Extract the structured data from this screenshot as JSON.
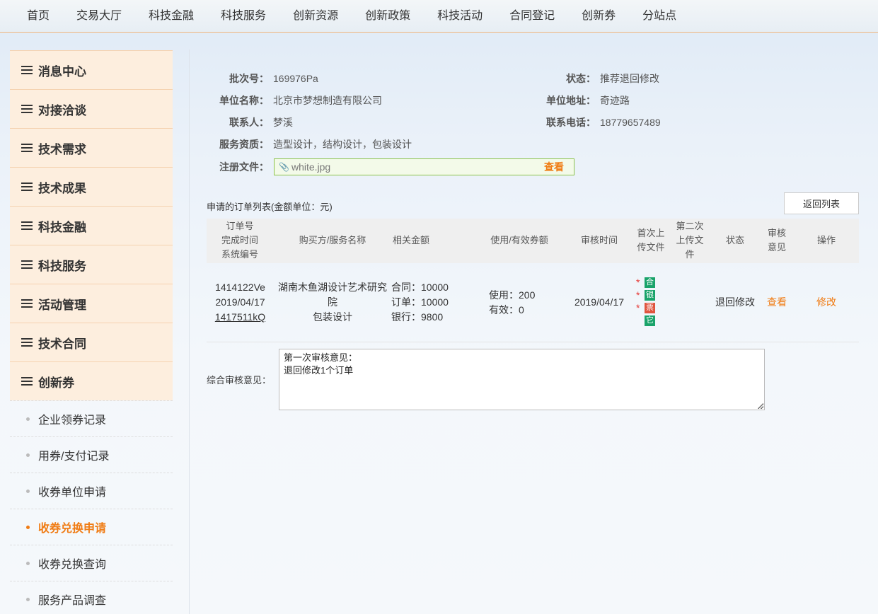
{
  "nav": [
    "首页",
    "交易大厅",
    "科技金融",
    "科技服务",
    "创新资源",
    "创新政策",
    "科技活动",
    "合同登记",
    "创新券",
    "分站点"
  ],
  "sidebar": {
    "heads": [
      "消息中心",
      "对接洽谈",
      "技术需求",
      "技术成果",
      "科技金融",
      "科技服务",
      "活动管理",
      "技术合同",
      "创新券"
    ],
    "subs": [
      {
        "label": "企业领券记录",
        "active": false
      },
      {
        "label": "用券/支付记录",
        "active": false
      },
      {
        "label": "收券单位申请",
        "active": false
      },
      {
        "label": "收券兑换申请",
        "active": true
      },
      {
        "label": "收券兑换查询",
        "active": false
      },
      {
        "label": "服务产品调查",
        "active": false
      }
    ]
  },
  "info": {
    "batch_label": "批次号：",
    "batch_value": "169976Pa",
    "status_label": "状态：",
    "status_value": "推荐退回修改",
    "unit_label": "单位名称：",
    "unit_value": "北京市梦想制造有限公司",
    "address_label": "单位地址：",
    "address_value": "奇迹路",
    "contact_label": "联系人：",
    "contact_value": "梦溪",
    "phone_label": "联系电话：",
    "phone_value": "18779657489",
    "qual_label": "服务资质：",
    "qual_value": "造型设计，结构设计，包装设计",
    "file_label": "注册文件：",
    "file_name": "white.jpg",
    "file_view": "查看"
  },
  "orders": {
    "title": "申请的订单列表(金额单位：元)",
    "back_button": "返回列表",
    "headers": {
      "col1": [
        "订单号",
        "完成时间",
        "系统编号"
      ],
      "buyer": "购买方/服务名称",
      "amount": "相关金额",
      "usage": "使用/有效券额",
      "review_time": "审核时间",
      "first_upload": [
        "首次上",
        "传文件"
      ],
      "second_upload": [
        "第二次",
        "上传文",
        "件"
      ],
      "status": "状态",
      "opinion": [
        "审核",
        "意见"
      ],
      "action": "操作"
    },
    "row": {
      "order_no": "1414122Ve",
      "finish_date": "2019/04/17",
      "sys_no": "1417511kQ",
      "buyer": [
        "湖南木鱼湖设计艺术研究",
        "院"
      ],
      "service": "包装设计",
      "amounts": [
        "合同：10000",
        "订单：10000",
        "银行：9800"
      ],
      "usage": [
        "使用：200",
        "有效：0"
      ],
      "review_time": "2019/04/17",
      "files": [
        {
          "star": "*",
          "label": "合",
          "color": "#1aa36a"
        },
        {
          "star": "*",
          "label": "银",
          "color": "#1aa36a"
        },
        {
          "star": "*",
          "label": "票",
          "color": "#e0553f"
        },
        {
          "star": "",
          "label": "它",
          "color": "#1aa36a"
        }
      ],
      "status": "退回修改",
      "opinion_link": "查看",
      "action_link": "修改"
    }
  },
  "review": {
    "label": "综合审核意见：",
    "lines": [
      "第一次审核意见：",
      "退回修改1个订单"
    ]
  }
}
